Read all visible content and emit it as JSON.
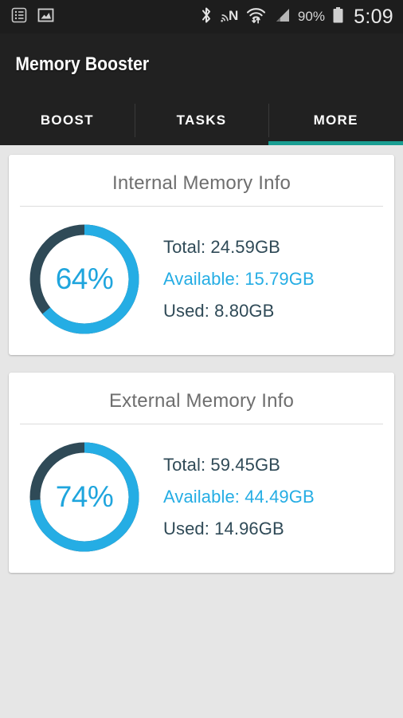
{
  "status_bar": {
    "left_icons": [
      {
        "name": "notes-list-icon",
        "glyph": "list"
      },
      {
        "name": "photo-image-icon",
        "glyph": "image"
      }
    ],
    "right_icons": [
      {
        "name": "bluetooth-icon",
        "glyph": "bluetooth"
      },
      {
        "name": "nfc-icon",
        "glyph": "nfc"
      },
      {
        "name": "wifi-icon",
        "glyph": "wifi"
      },
      {
        "name": "cellular-signal-icon",
        "glyph": "signal"
      }
    ],
    "battery_percent": "90%",
    "clock": "5:09"
  },
  "app_bar": {
    "title": "Memory Booster"
  },
  "tabs": {
    "items": [
      {
        "label": "BOOST",
        "active": false
      },
      {
        "label": "TASKS",
        "active": false
      },
      {
        "label": "MORE",
        "active": true
      }
    ],
    "indicator_color": "#1a9e92"
  },
  "colors": {
    "used_arc": "#25ade4",
    "free_arc": "#2f4a57",
    "percent_text": "#1fa5dd",
    "available_text": "#25ade4",
    "label_text": "#2f4a57",
    "background": "#e6e6e6",
    "card": "#ffffff",
    "appbar": "#212121",
    "statusbar": "#1d1d1d"
  },
  "cards": [
    {
      "title": "Internal Memory Info",
      "percent_label": "64%",
      "percent_value": 64,
      "stats": [
        {
          "label": "Total: 24.59GB",
          "kind": "total"
        },
        {
          "label": "Available: 15.79GB",
          "kind": "available"
        },
        {
          "label": "Used: 8.80GB",
          "kind": "used"
        }
      ]
    },
    {
      "title": "External Memory Info",
      "percent_label": "74%",
      "percent_value": 74,
      "stats": [
        {
          "label": "Total: 59.45GB",
          "kind": "total"
        },
        {
          "label": "Available: 44.49GB",
          "kind": "available"
        },
        {
          "label": "Used: 14.96GB",
          "kind": "used"
        }
      ]
    }
  ],
  "chart_data": {
    "type": "pie",
    "title": "Memory usage donut gauges",
    "charts": [
      {
        "name": "Internal Memory Info",
        "type": "pie",
        "categories": [
          "Used portion",
          "Free portion"
        ],
        "values": [
          64,
          36
        ],
        "unit": "%",
        "center_label": "64%",
        "colors": [
          "#25ade4",
          "#2f4a57"
        ],
        "start_angle_deg": 0,
        "direction": "clockwise",
        "total_gb": 24.59,
        "available_gb": 15.79,
        "used_gb": 8.8
      },
      {
        "name": "External Memory Info",
        "type": "pie",
        "categories": [
          "Used portion",
          "Free portion"
        ],
        "values": [
          74,
          26
        ],
        "unit": "%",
        "center_label": "74%",
        "colors": [
          "#25ade4",
          "#2f4a57"
        ],
        "start_angle_deg": 0,
        "direction": "clockwise",
        "total_gb": 59.45,
        "available_gb": 44.49,
        "used_gb": 14.96
      }
    ]
  }
}
